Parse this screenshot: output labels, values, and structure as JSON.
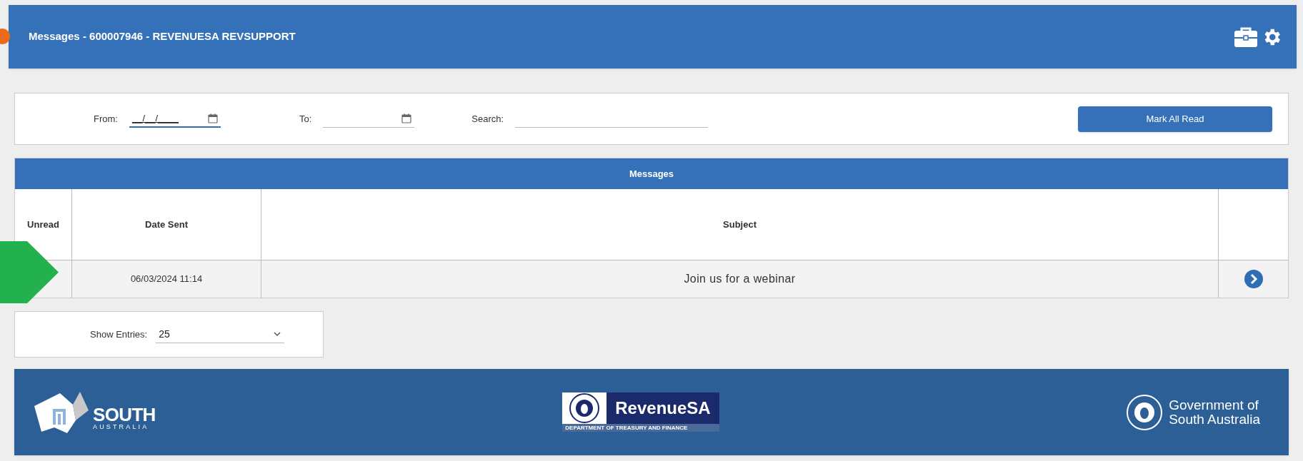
{
  "header": {
    "title": "Messages - 600007946 - REVENUESA REVSUPPORT"
  },
  "filters": {
    "from": {
      "label": "From:",
      "value": "__/__/____",
      "focused": true
    },
    "to": {
      "label": "To:",
      "focused": false
    },
    "search": {
      "label": "Search:"
    },
    "mark_all_read": "Mark All Read"
  },
  "table": {
    "title": "Messages",
    "columns": [
      "Unread",
      "Date Sent",
      "Subject"
    ],
    "rows": [
      {
        "date_sent": "06/03/2024 11:14",
        "subject": "Join us for a webinar"
      }
    ]
  },
  "show_entries": {
    "label": "Show Entries:",
    "value": "25"
  },
  "footer": {
    "logos": [
      {
        "kind": "south_australia",
        "text": "SOUTH",
        "subtext": "AUSTRALIA"
      },
      {
        "kind": "revenuesa",
        "text": "RevenueSA",
        "subtext": "DEPARTMENT OF TREASURY AND FINANCE"
      },
      {
        "kind": "government",
        "lines": [
          "Government of",
          "South Australia"
        ]
      }
    ]
  }
}
